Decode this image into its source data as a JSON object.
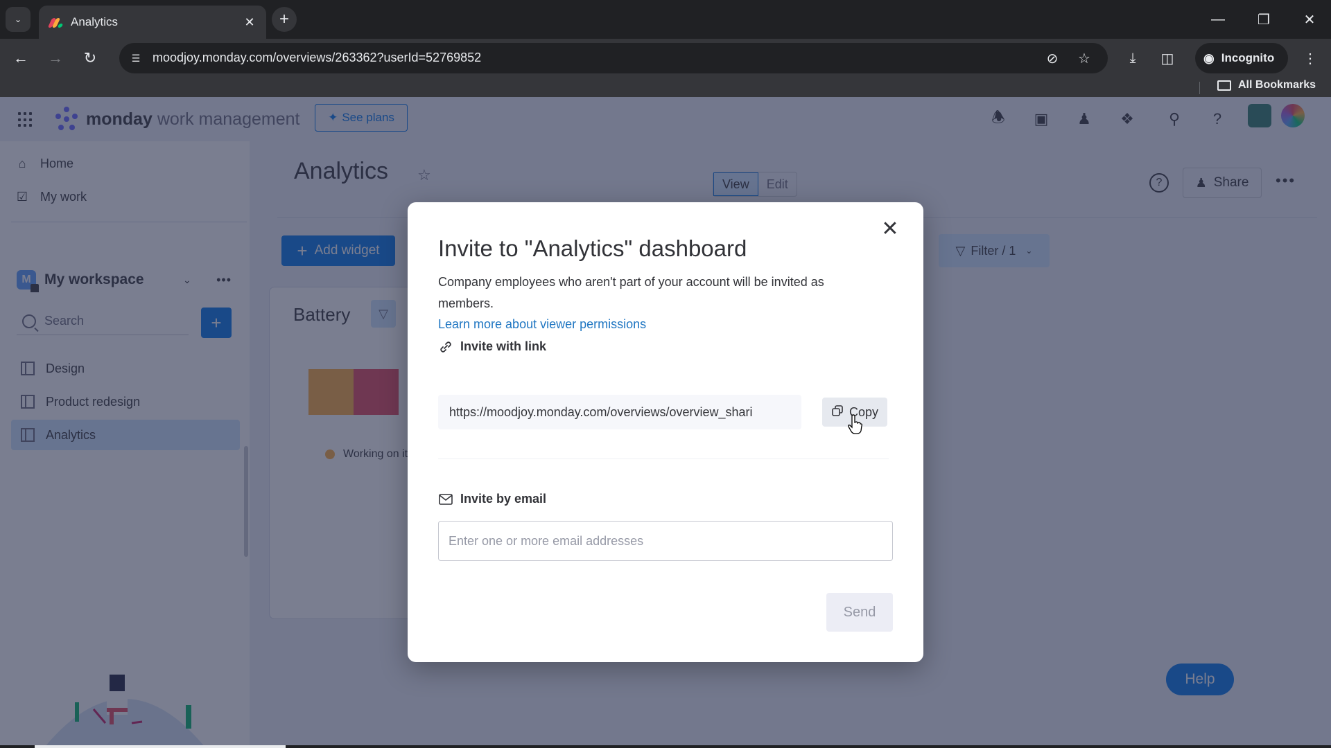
{
  "browser": {
    "tab_title": "Analytics",
    "url": "moodjoy.monday.com/overviews/263362?userId=52769852",
    "incognito_label": "Incognito",
    "bookmarks_label": "All Bookmarks"
  },
  "app": {
    "logo_bold": "monday",
    "logo_light": "work management",
    "see_plans_label": "See plans",
    "sidebar": {
      "home_label": "Home",
      "my_work_label": "My work",
      "workspace_initial": "M",
      "workspace_name": "My workspace",
      "search_placeholder": "Search",
      "boards": [
        {
          "label": "Design",
          "active": false
        },
        {
          "label": "Product redesign",
          "active": false
        },
        {
          "label": "Analytics",
          "active": true
        }
      ]
    },
    "main": {
      "page_title": "Analytics",
      "view_label": "View",
      "edit_label": "Edit",
      "share_label": "Share",
      "add_widget_label": "Add widget",
      "filter_label": "Filter / 1",
      "widget": {
        "title": "Battery",
        "segments": [
          {
            "color": "#fdab3d",
            "share": 0.5
          },
          {
            "color": "#e2445c",
            "share": 0.5
          }
        ],
        "legend_label": "Working on it",
        "legend_color": "#fdab3d"
      },
      "help_label": "Help"
    }
  },
  "modal": {
    "title": "Invite to \"Analytics\" dashboard",
    "description": "Company employees who aren't part of your account will be invited as members.",
    "learn_more_link": "Learn more about viewer permissions",
    "invite_link_heading": "Invite with link",
    "invite_link_value": "https://moodjoy.monday.com/overviews/overview_shari",
    "copy_label": "Copy",
    "invite_email_heading": "Invite by email",
    "email_placeholder": "Enter one or more email addresses",
    "send_label": "Send"
  }
}
